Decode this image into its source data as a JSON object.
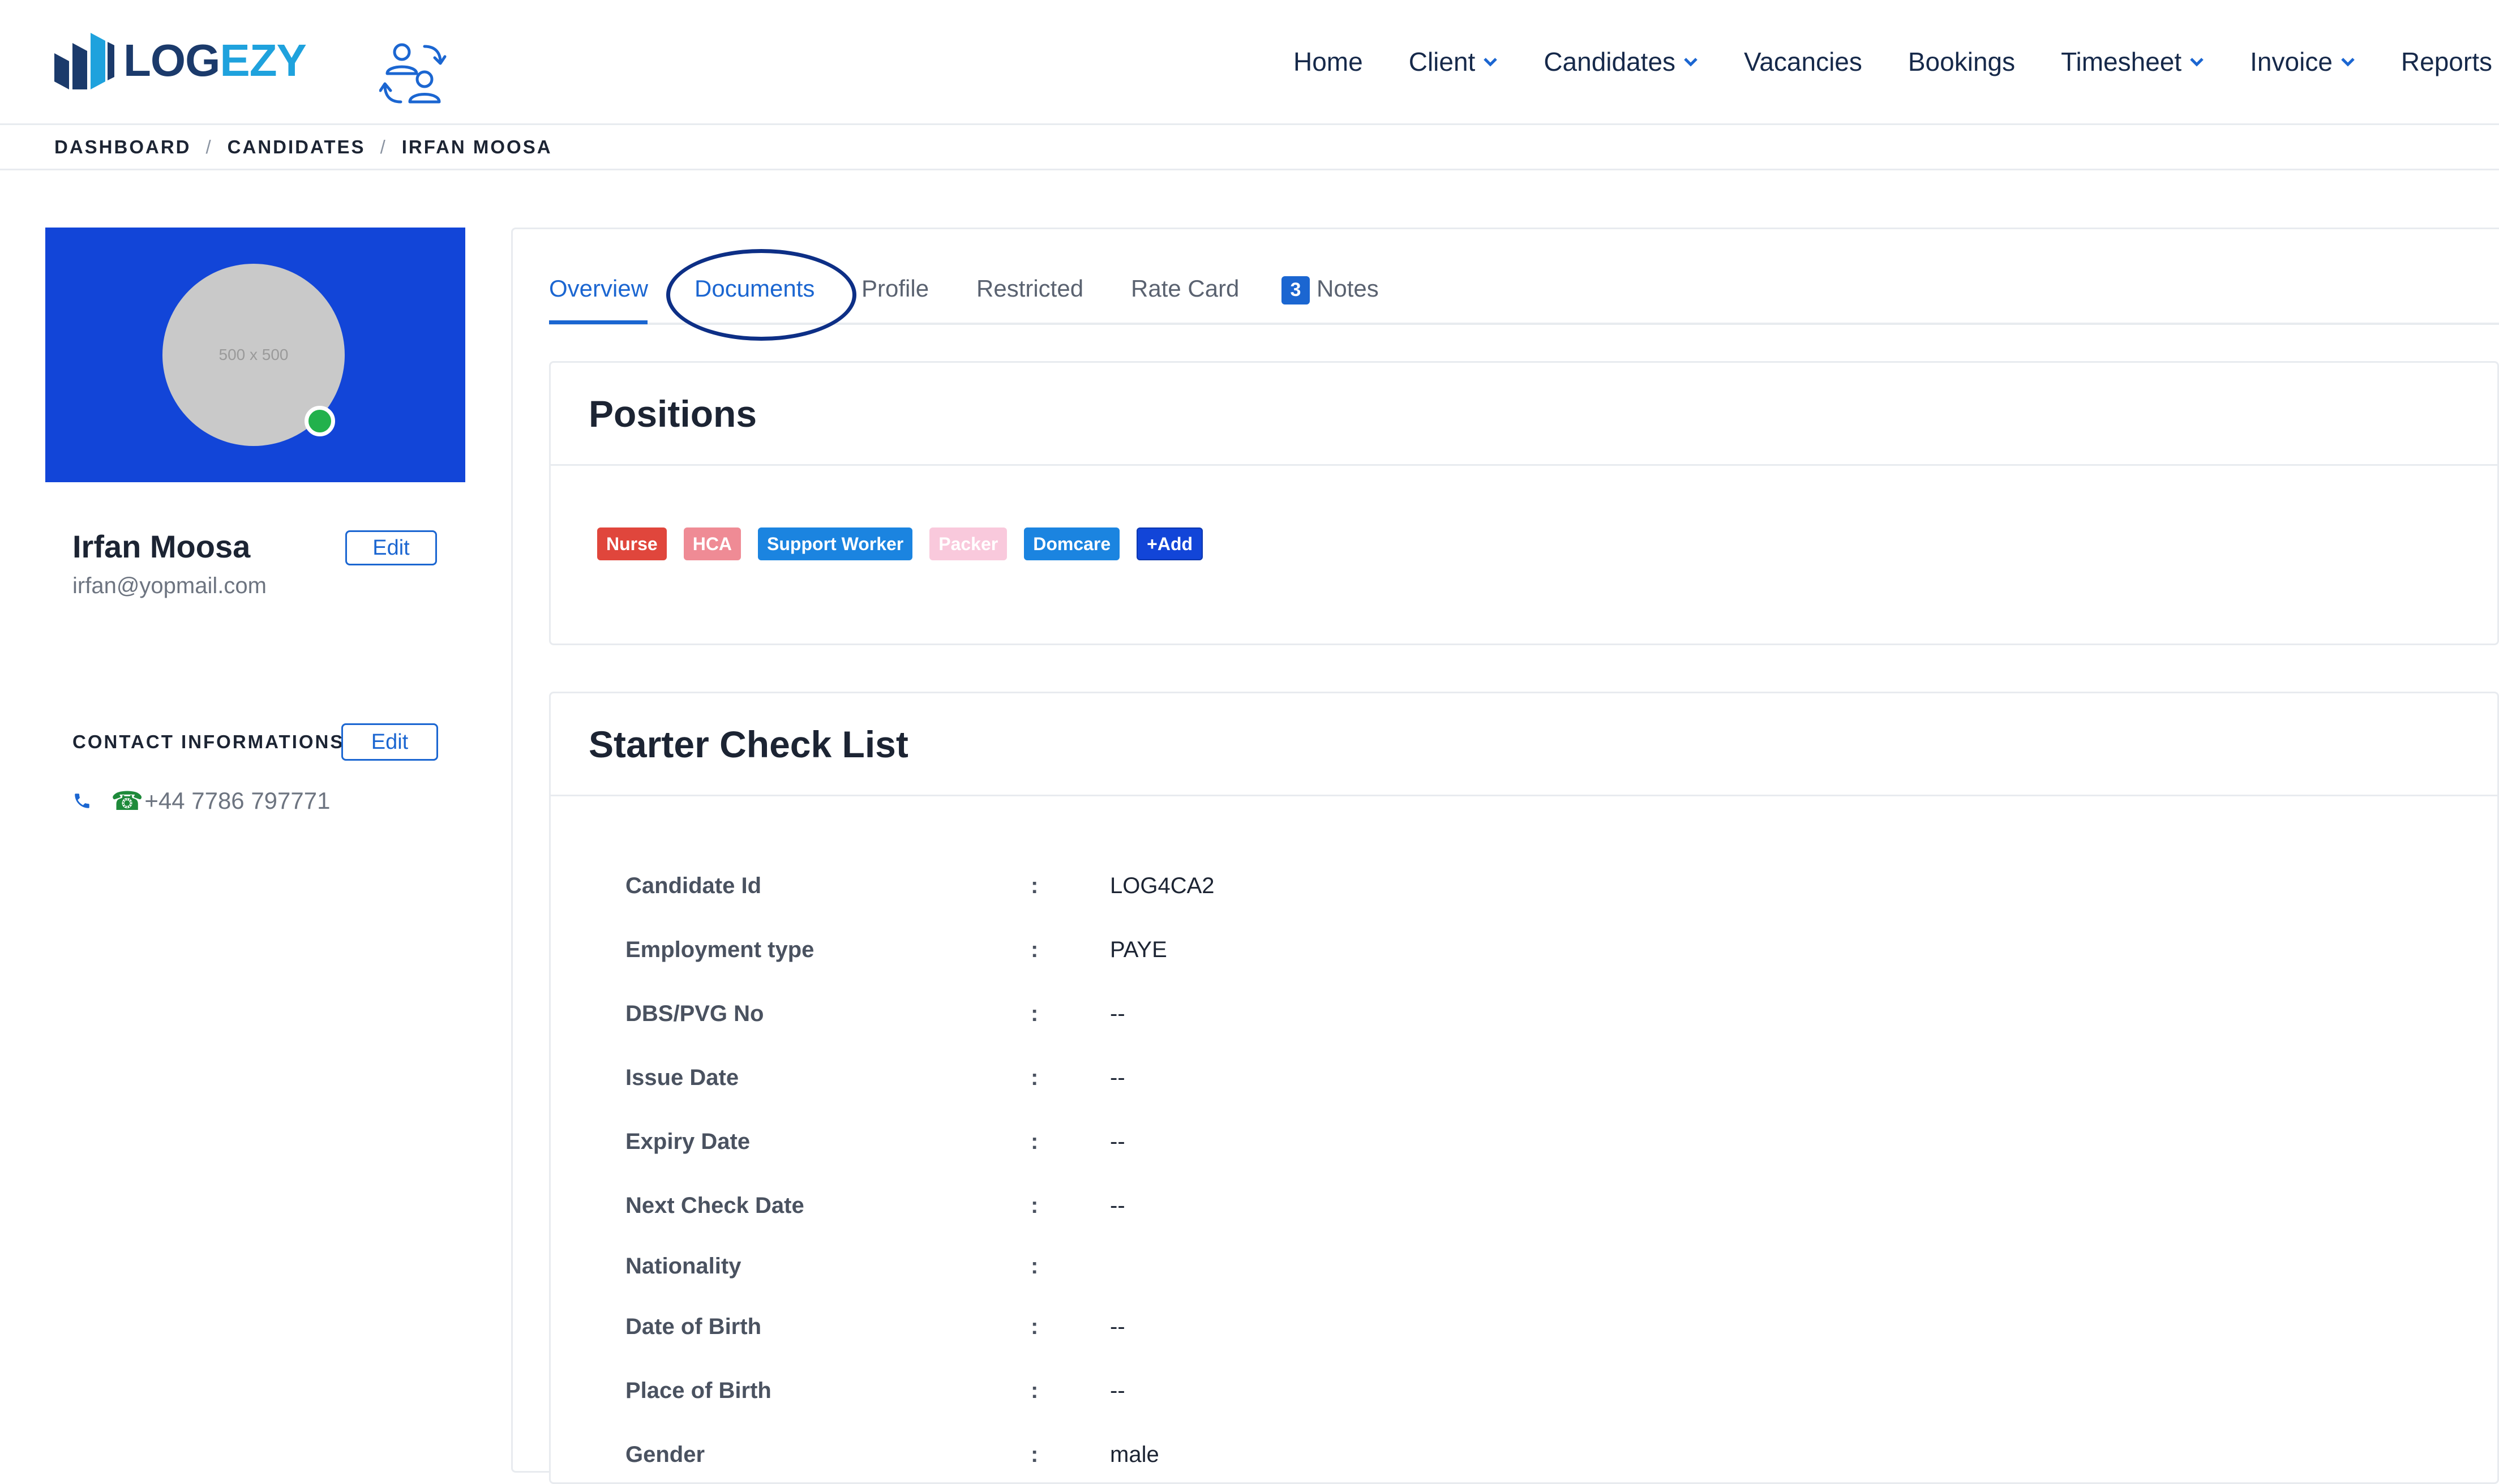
{
  "header": {
    "logo": {
      "part1": "LOG",
      "part2": "EZY"
    },
    "switch_icon": "switch-user-icon",
    "nav": [
      {
        "label": "Home",
        "dropdown": false
      },
      {
        "label": "Client",
        "dropdown": true
      },
      {
        "label": "Candidates",
        "dropdown": true
      },
      {
        "label": "Vacancies",
        "dropdown": false
      },
      {
        "label": "Bookings",
        "dropdown": false
      },
      {
        "label": "Timesheet",
        "dropdown": true
      },
      {
        "label": "Invoice",
        "dropdown": true
      },
      {
        "label": "Reports",
        "dropdown": false
      }
    ]
  },
  "breadcrumb": [
    "DASHBOARD",
    "CANDIDATES",
    "IRFAN MOOSA"
  ],
  "profile": {
    "avatar_placeholder": "500 x 500",
    "name": "Irfan Moosa",
    "email": "irfan@yopmail.com",
    "edit_label": "Edit",
    "contact_title": "CONTACT INFORMATIONS",
    "contact_edit_label": "Edit",
    "phone_prefix_glyph": "☎",
    "phone": "+44 7786 797771",
    "online_color": "#22b14c",
    "cover_color": "#1245d8"
  },
  "tabs": [
    {
      "label": "Overview",
      "active": true
    },
    {
      "label": "Documents",
      "active": false,
      "highlighted": true
    },
    {
      "label": "Profile",
      "active": false
    },
    {
      "label": "Restricted",
      "active": false
    },
    {
      "label": "Rate Card",
      "active": false
    },
    {
      "label": "Notes",
      "active": false,
      "badge": "3"
    }
  ],
  "positions": {
    "title": "Positions",
    "tags": [
      {
        "label": "Nurse",
        "color": "#e0463c"
      },
      {
        "label": "HCA",
        "color": "#ef8b95"
      },
      {
        "label": "Support Worker",
        "color": "#1b84e0"
      },
      {
        "label": "Packer",
        "color": "#f9c9dc"
      },
      {
        "label": "Domcare",
        "color": "#1b84e0"
      }
    ],
    "add_label": "+Add",
    "add_color": "#1245d8"
  },
  "checklist": {
    "title": "Starter Check List",
    "rows": [
      {
        "label": "Candidate Id",
        "value": "LOG4CA2"
      },
      {
        "label": "Employment type",
        "value": "PAYE"
      },
      {
        "label": "DBS/PVG No",
        "value": "--"
      },
      {
        "label": "Issue Date",
        "value": "--"
      },
      {
        "label": "Expiry Date",
        "value": "--"
      },
      {
        "label": "Next Check Date",
        "value": "--"
      },
      {
        "label": "Nationality",
        "value": ""
      },
      {
        "label": "Date of Birth",
        "value": "--"
      },
      {
        "label": "Place of Birth",
        "value": "--"
      },
      {
        "label": "Gender",
        "value": "male"
      }
    ]
  },
  "accent_color": "#1b66d1"
}
